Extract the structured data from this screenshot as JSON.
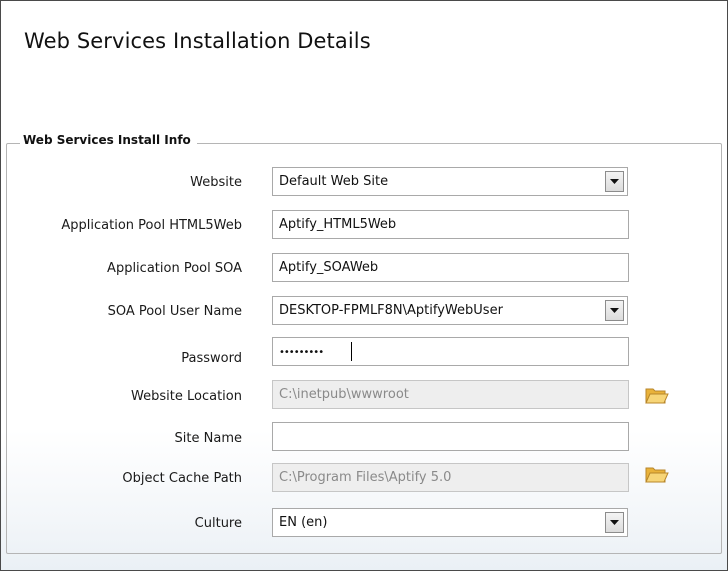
{
  "page": {
    "title": "Web Services Installation Details"
  },
  "group": {
    "legend": "Web Services Install Info"
  },
  "fields": {
    "website": {
      "label": "Website",
      "value": "Default Web Site"
    },
    "app_pool_html5": {
      "label": "Application Pool HTML5Web",
      "value": "Aptify_HTML5Web"
    },
    "app_pool_soa": {
      "label": "Application Pool SOA",
      "value": "Aptify_SOAWeb"
    },
    "soa_user": {
      "label": "SOA Pool User Name",
      "value": "DESKTOP-FPMLF8N\\AptifyWebUser"
    },
    "password": {
      "label": "Password",
      "value": "•••••••••"
    },
    "website_location": {
      "label": "Website Location",
      "value": "C:\\inetpub\\wwwroot"
    },
    "site_name": {
      "label": "Site Name",
      "value": ""
    },
    "object_cache_path": {
      "label": "Object Cache Path",
      "value": "C:\\Program Files\\Aptify 5.0"
    },
    "culture": {
      "label": "Culture",
      "value": "EN (en)"
    }
  },
  "icons": {
    "folder": "folder-open-icon",
    "dropdown": "chevron-down-icon"
  },
  "colors": {
    "folder": "#f2c34a",
    "disabled_bg": "#eeeeee",
    "disabled_text": "#8a8a8a"
  }
}
